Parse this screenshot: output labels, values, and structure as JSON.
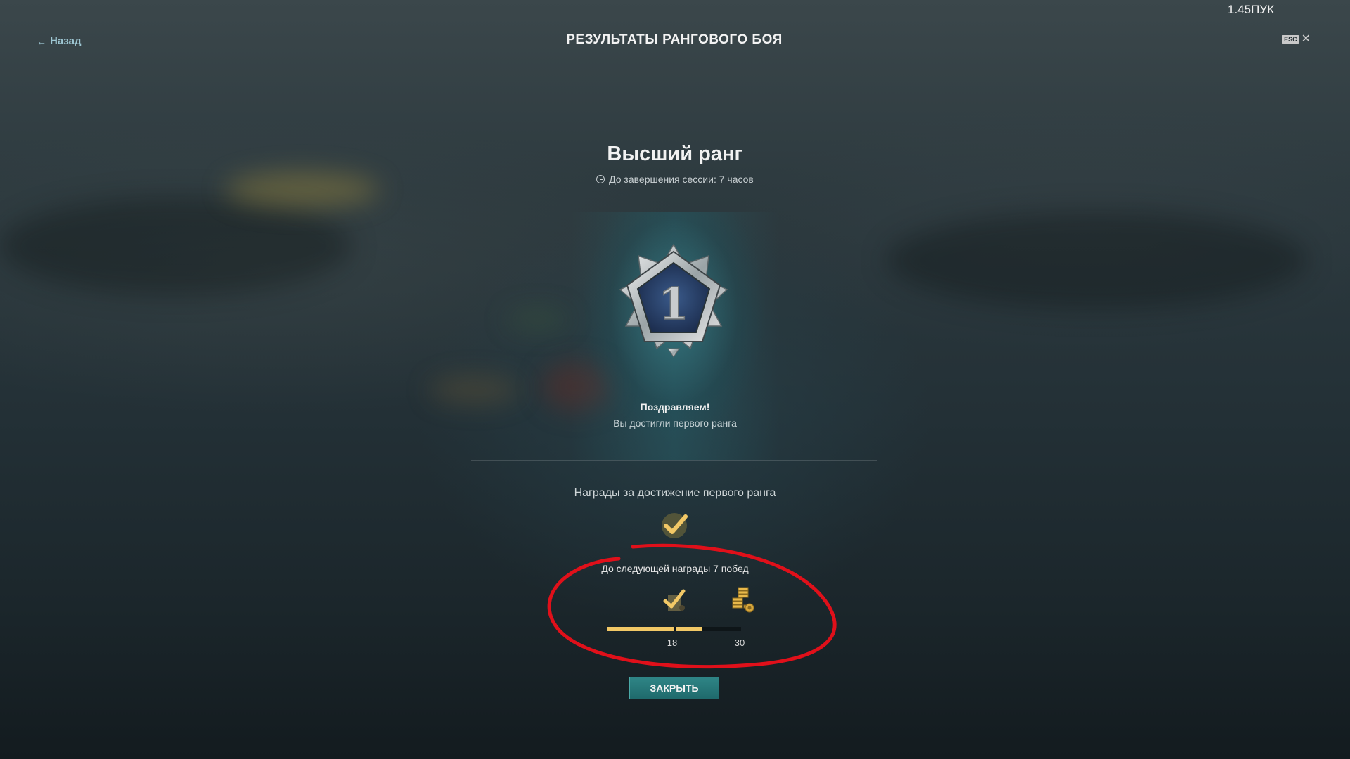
{
  "version": "1.45ПУК",
  "header": {
    "back_label": "Назад",
    "title": "РЕЗУЛЬТАТЫ РАНГОВОГО БОЯ",
    "esc_label": "ESC",
    "close_symbol": "✕"
  },
  "rank": {
    "title": "Высший ранг",
    "session_text": "До завершения сессии: 7 часов",
    "badge_number": "1",
    "congrats": "Поздравляем!",
    "reached_text": "Вы достигли первого ранга"
  },
  "rewards": {
    "title": "Награды за достижение первого ранга",
    "next_reward_text": "До следующей награды 7 побед",
    "progress": {
      "milestones": [
        "18",
        "30"
      ],
      "filled_fraction": 0.71,
      "milestone_fraction": 0.5
    }
  },
  "close_button_label": "ЗАКРЫТЬ",
  "icons": {
    "back": "arrow-left-icon",
    "clock": "clock-icon",
    "reward_main": "flag-check-icon",
    "reward_small": "flag-check-icon",
    "coins": "coins-icon"
  },
  "colors": {
    "accent_gold": "#f2c866",
    "button_teal": "#2f8586",
    "annotation_red": "#e0101a"
  }
}
